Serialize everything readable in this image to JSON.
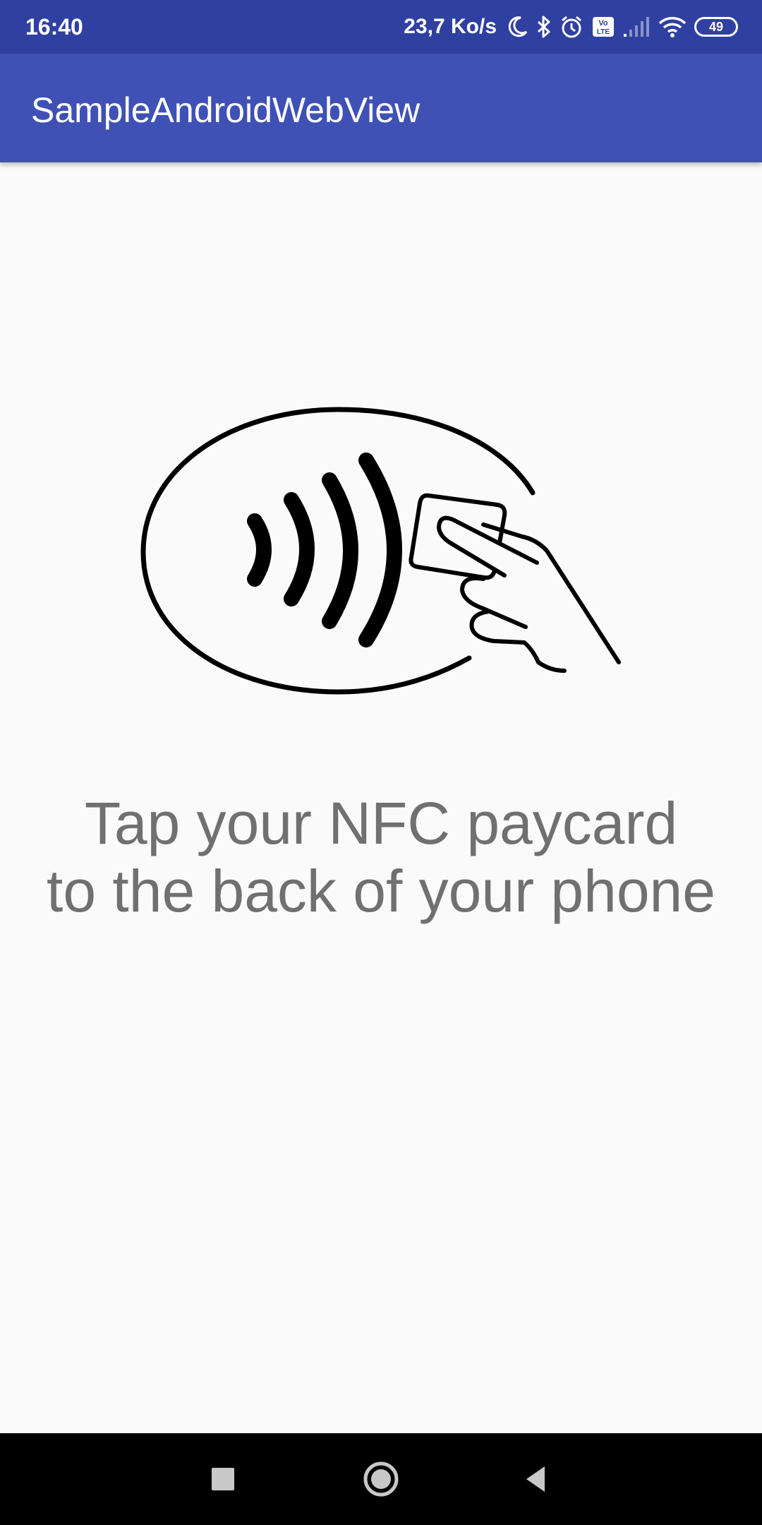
{
  "status_bar": {
    "time": "16:40",
    "net_speed": "23,7 Ko/s",
    "battery_level": "49",
    "icons": [
      "moon-icon",
      "bluetooth-icon",
      "alarm-icon",
      "volte-icon",
      "signal-icon",
      "wifi-icon",
      "battery-icon"
    ]
  },
  "app_bar": {
    "title": "SampleAndroidWebView",
    "color": "#3f51b5"
  },
  "main": {
    "illustration_icon": "nfc-contactless-card-tap-icon",
    "instruction_line1": "Tap your NFC paycard",
    "instruction_line2": "to the back of your phone"
  },
  "nav_bar": {
    "buttons": [
      "recents-icon",
      "home-icon",
      "back-icon"
    ]
  }
}
